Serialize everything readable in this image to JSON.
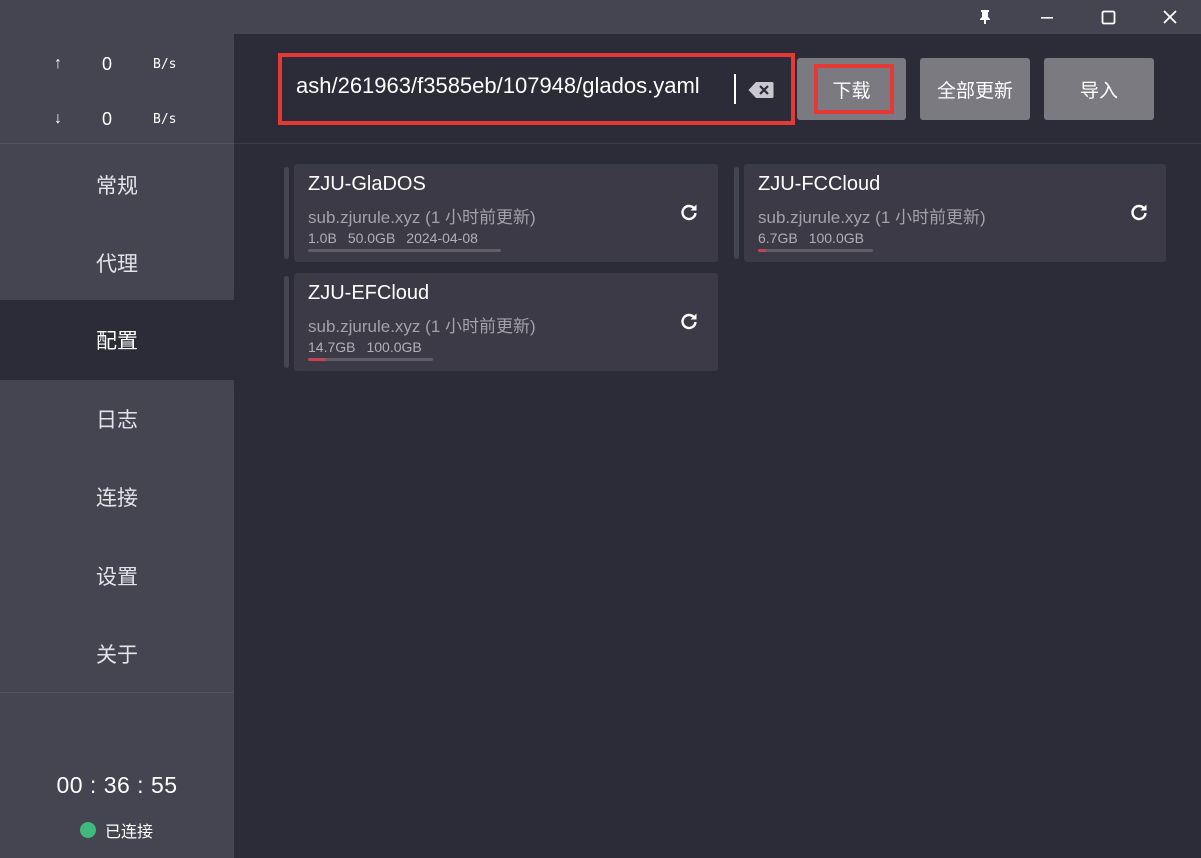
{
  "window": {
    "pin_icon": "pin-icon",
    "minimize_icon": "minimize-icon",
    "maximize_icon": "maximize-icon",
    "close_icon": "close-icon"
  },
  "traffic": {
    "upload": {
      "arrow": "↑",
      "value": "0",
      "unit": "B/s"
    },
    "download": {
      "arrow": "↓",
      "value": "0",
      "unit": "B/s"
    }
  },
  "nav": {
    "items": [
      {
        "label": "常规"
      },
      {
        "label": "代理"
      },
      {
        "label": "配置"
      },
      {
        "label": "日志"
      },
      {
        "label": "连接"
      },
      {
        "label": "设置"
      },
      {
        "label": "关于"
      }
    ],
    "active": "配置"
  },
  "timer": "00 : 36 : 55",
  "status": {
    "label": "已连接",
    "color": "#3fb97c"
  },
  "toolbar": {
    "url_value": "ash/261963/f3585eb/107948/glados.yaml",
    "download_label": "下载",
    "update_all_label": "全部更新",
    "import_label": "导入"
  },
  "profiles": [
    {
      "name": "ZJU-GlaDOS",
      "host": "sub.zjurule.xyz (1 小时前更新)",
      "used": "1.0B",
      "total": "50.0GB",
      "expire": "2024-04-08",
      "usage_fraction": 0.0
    },
    {
      "name": "ZJU-FCCloud",
      "host": "sub.zjurule.xyz (1 小时前更新)",
      "used": "6.7GB",
      "total": "100.0GB",
      "expire": "",
      "usage_fraction": 0.067
    },
    {
      "name": "ZJU-EFCloud",
      "host": "sub.zjurule.xyz (1 小时前更新)",
      "used": "14.7GB",
      "total": "100.0GB",
      "expire": "",
      "usage_fraction": 0.147
    }
  ],
  "colors": {
    "accent_red": "#e53935",
    "progress_fill": "#c24450",
    "background": "#2c2b38",
    "sidebar": "#454451"
  }
}
